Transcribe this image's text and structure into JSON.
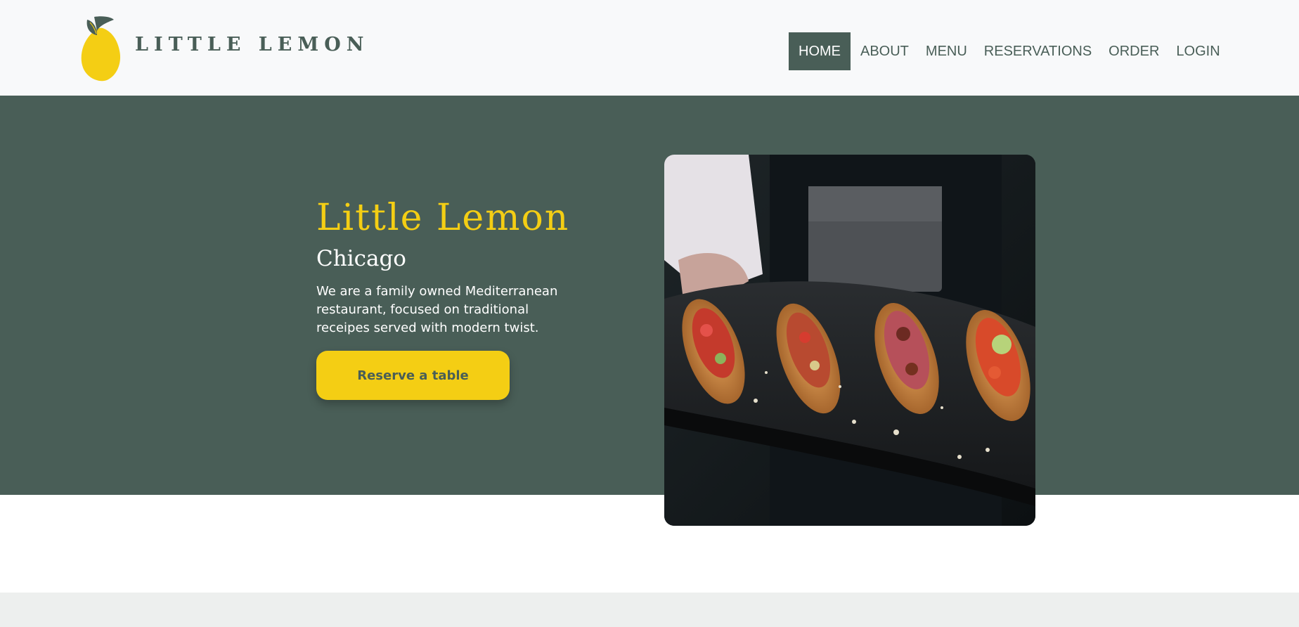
{
  "header": {
    "logo_text": "LITTLE LEMON",
    "logo_icon": "lemon-icon",
    "nav": [
      {
        "label": "HOME",
        "active": true
      },
      {
        "label": "ABOUT",
        "active": false
      },
      {
        "label": "MENU",
        "active": false
      },
      {
        "label": "RESERVATIONS",
        "active": false
      },
      {
        "label": "ORDER",
        "active": false
      },
      {
        "label": "LOGIN",
        "active": false
      }
    ]
  },
  "hero": {
    "title": "Little Lemon",
    "subtitle": "Chicago",
    "description": "We are a family owned Mediterranean restaurant, focused on traditional receipes served with modern twist.",
    "cta_label": "Reserve a table",
    "image_subject": "waiter-holding-slate-of-bruschetta"
  },
  "colors": {
    "primary_green": "#495e57",
    "primary_yellow": "#f4ce14",
    "header_bg": "#f8f9fa",
    "footer_bg": "#edefee"
  }
}
